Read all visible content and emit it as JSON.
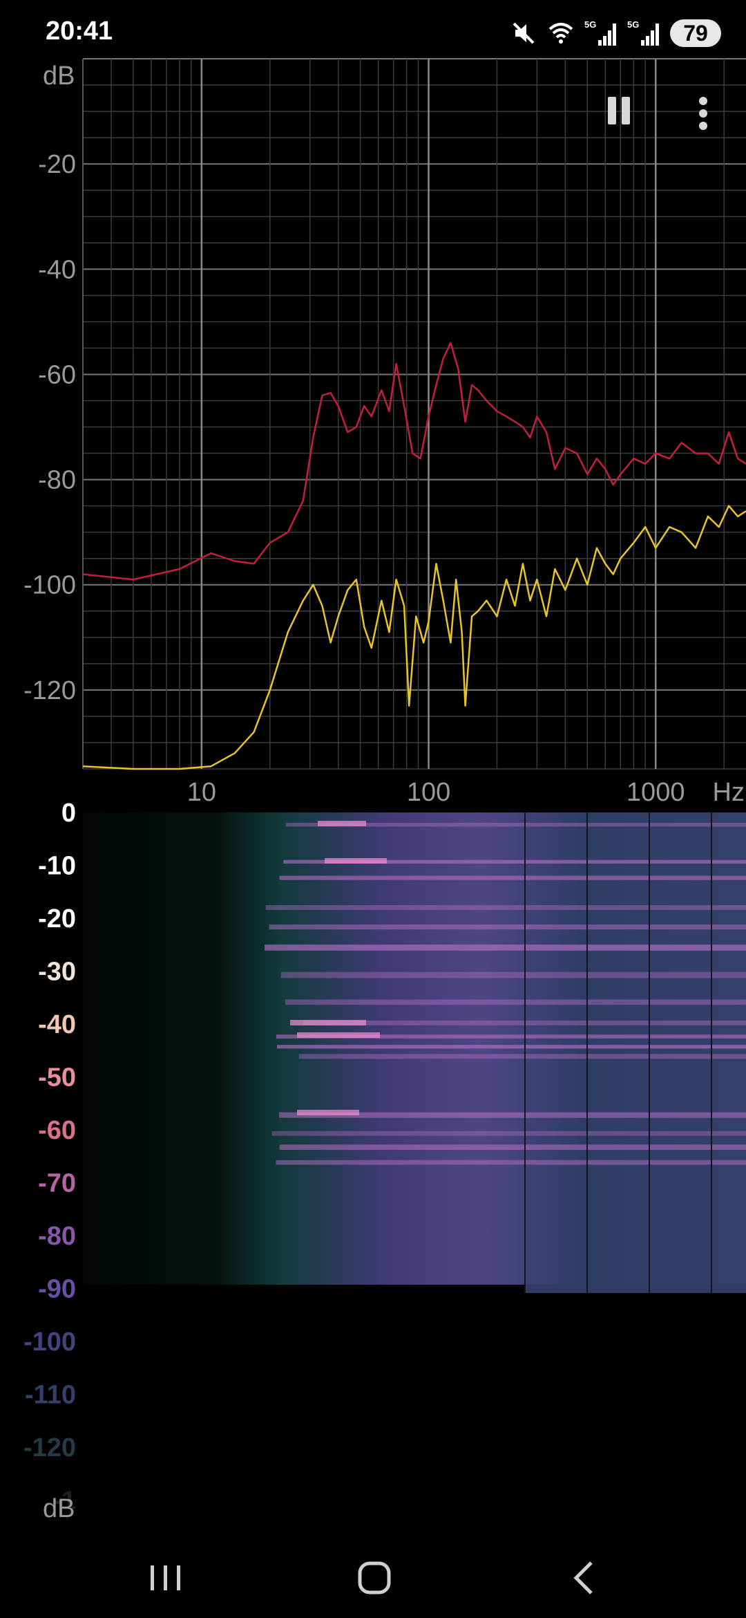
{
  "status_bar": {
    "time": "20:41",
    "icons": [
      "mute-icon",
      "wifi-icon",
      "signal-5g-icon",
      "signal-5g-icon"
    ],
    "network_label_1": "5G",
    "network_label_2": "5G",
    "battery": "79"
  },
  "toolbar": {
    "pause_icon": "pause-icon",
    "more_icon": "more-vertical-icon"
  },
  "spectrum": {
    "y_unit": "dB",
    "y_ticks": [
      "-20",
      "-40",
      "-60",
      "-80",
      "-100",
      "-120"
    ],
    "x_ticks": [
      "10",
      "100",
      "1000"
    ],
    "x_unit": "Hz",
    "line_colors": {
      "peak": "#c2203c",
      "current": "#e8c52a"
    },
    "chart_data": {
      "type": "line",
      "x_scale": "log",
      "xlim": [
        3,
        2500
      ],
      "ylim": [
        -135,
        0
      ],
      "series": [
        {
          "color": "#c2203c",
          "x": [
            3,
            5,
            8,
            11,
            14,
            17,
            20,
            24,
            28,
            31,
            34,
            37,
            40,
            44,
            48,
            52,
            56,
            62,
            67,
            72,
            78,
            85,
            92,
            100,
            108,
            116,
            125,
            135,
            145,
            155,
            165,
            180,
            200,
            220,
            240,
            260,
            280,
            300,
            330,
            360,
            400,
            450,
            500,
            550,
            600,
            650,
            700,
            800,
            900,
            1000,
            1150,
            1300,
            1500,
            1700,
            1900,
            2100,
            2300,
            2500
          ],
          "y": [
            -98,
            -99,
            -97,
            -94,
            -95.5,
            -96,
            -92,
            -90,
            -84,
            -72,
            -64,
            -63.5,
            -66,
            -71,
            -70,
            -66,
            -68,
            -63,
            -67,
            -58,
            -66,
            -75,
            -76,
            -68,
            -62,
            -57,
            -54,
            -59,
            -69,
            -62,
            -63,
            -65,
            -67,
            -68,
            -69,
            -70,
            -72,
            -68,
            -71,
            -78,
            -74,
            -75,
            -79,
            -76,
            -78,
            -81,
            -79,
            -76,
            -77,
            -75,
            -76,
            -73,
            -75,
            -75,
            -77,
            -71,
            -76,
            -77
          ]
        },
        {
          "color": "#e8c52a",
          "x": [
            3,
            5,
            8,
            11,
            14,
            17,
            20,
            24,
            28,
            31,
            34,
            37,
            40,
            44,
            48,
            52,
            56,
            62,
            67,
            72,
            78,
            82,
            88,
            95,
            100,
            108,
            116,
            125,
            132,
            140,
            145,
            155,
            165,
            180,
            200,
            220,
            240,
            260,
            280,
            300,
            330,
            360,
            400,
            450,
            500,
            550,
            600,
            650,
            700,
            800,
            900,
            1000,
            1150,
            1300,
            1500,
            1700,
            1900,
            2100,
            2300,
            2500
          ],
          "y": [
            -134.5,
            -135,
            -135,
            -134.5,
            -132,
            -128,
            -120,
            -109,
            -103,
            -100,
            -104,
            -111,
            -106,
            -101,
            -99,
            -108,
            -112,
            -103,
            -109,
            -99,
            -104,
            -123,
            -106,
            -111,
            -107,
            -96,
            -103,
            -111,
            -99,
            -109,
            -123,
            -106,
            -105,
            -103,
            -106,
            -99,
            -104,
            -96,
            -103,
            -99,
            -106,
            -97,
            -101,
            -95,
            -100,
            -93,
            -96,
            -98,
            -95,
            -92,
            -89,
            -93,
            -89,
            -90,
            -93,
            -87,
            -89,
            -85,
            -87,
            -86
          ]
        }
      ]
    }
  },
  "spectrogram": {
    "y_ticks": [
      "0",
      "-10",
      "-20",
      "-30",
      "-40",
      "-50",
      "-60",
      "-70",
      "-80",
      "-90",
      "-100",
      "-110",
      "-120",
      "-1"
    ],
    "y_unit": "dB",
    "tick_colors": [
      "#ffffff",
      "#ffffff",
      "#ffffff",
      "#f3e4da",
      "#f0c6b4",
      "#e88f98",
      "#d9708e",
      "#b863a6",
      "#8a55ad",
      "#6a4ea6",
      "#43447f",
      "#34416a",
      "#243a45",
      "#192322"
    ]
  },
  "nav_bar": {
    "recents_icon": "recents-icon",
    "home_icon": "home-icon",
    "back_icon": "back-icon"
  }
}
